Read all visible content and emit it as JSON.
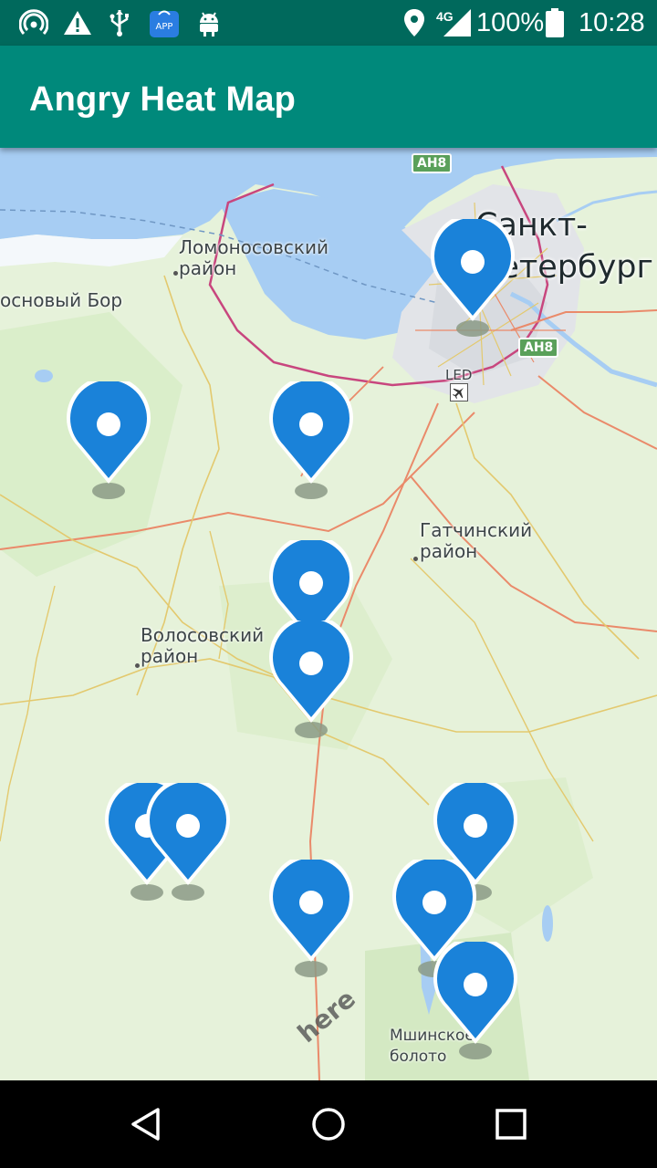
{
  "status_bar": {
    "battery_text": "100%",
    "time": "10:28",
    "network_label": "4G",
    "notification_app_label": "APP",
    "icons": [
      "hotspot-icon",
      "warning-icon",
      "usb-icon",
      "app-store-icon",
      "android-debug-icon",
      "location-icon",
      "signal-icon",
      "battery-icon"
    ]
  },
  "app_bar": {
    "title": "Angry Heat Map"
  },
  "map": {
    "city_label": "Санкт-\nПетербург",
    "labels": {
      "lomonosov": "Ломоносовский\nрайон",
      "sosnovy_bor": "Сосновый Бор",
      "volosovo": "Волосовский\nрайон",
      "gatchina": "Гатчинский\nрайон",
      "led": "LED",
      "mshinskoe": "Мшинское\nболото"
    },
    "road_badges": [
      "AH8",
      "AH8"
    ],
    "watermark": "here",
    "marker_color": "#1a82d9",
    "marker_count": 12
  },
  "nav_bar": {
    "buttons": [
      "back-icon",
      "home-icon",
      "recents-icon"
    ]
  }
}
